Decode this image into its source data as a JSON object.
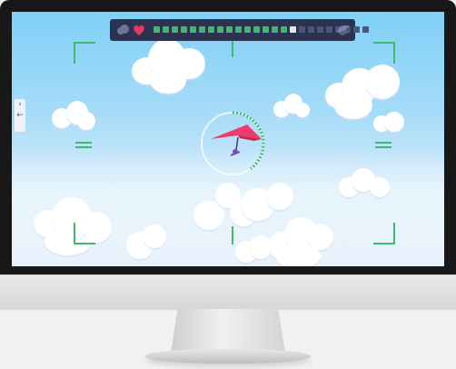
{
  "colors": {
    "sky_top": "#7fd0f6",
    "sky_bottom": "#dcebfa",
    "hud_bar": "#2c3350",
    "hud_green": "#3dbb6a",
    "segment_empty": "#4d5678",
    "segment_white": "#dfe6ee",
    "glider_red": "#ee3b6a",
    "pilot_purple": "#7a4fb0",
    "heart_red": "#e8375c"
  },
  "hud": {
    "progress_segments_total": 24,
    "progress_segments_filled": 15,
    "left_icon": "cloud-icon",
    "heart_icon": "heart-icon",
    "right_icon": "wing-icon"
  },
  "reticle": {
    "arc_fraction": 0.4
  },
  "side_tab": {
    "icons": [
      "chevron-left-icon",
      "left-arrow-icon"
    ]
  }
}
